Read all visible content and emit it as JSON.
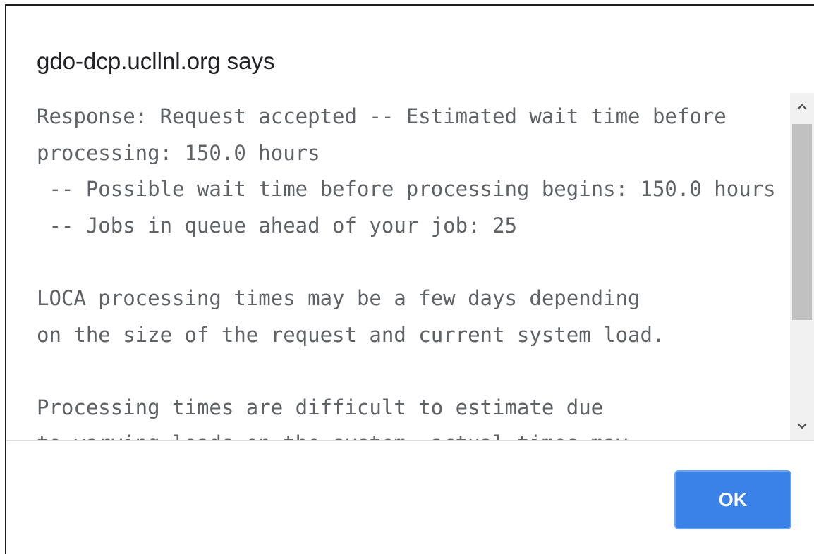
{
  "dialog": {
    "title": "gdo-dcp.ucllnl.org says",
    "message": "Response: Request accepted -- Estimated wait time before\nprocessing: 150.0 hours\n -- Possible wait time before processing begins: 150.0 hours\n -- Jobs in queue ahead of your job: 25\n\nLOCA processing times may be a few days depending\non the size of the request and current system load.\n\nProcessing times are difficult to estimate due\nto varying loads on the system, actual times may",
    "ok_label": "OK"
  },
  "scrollbar": {
    "up_icon": "chevron-up-icon",
    "down_icon": "chevron-down-icon"
  },
  "colors": {
    "button": "#3b82e8",
    "text": "#5f6368",
    "title": "#202124"
  }
}
